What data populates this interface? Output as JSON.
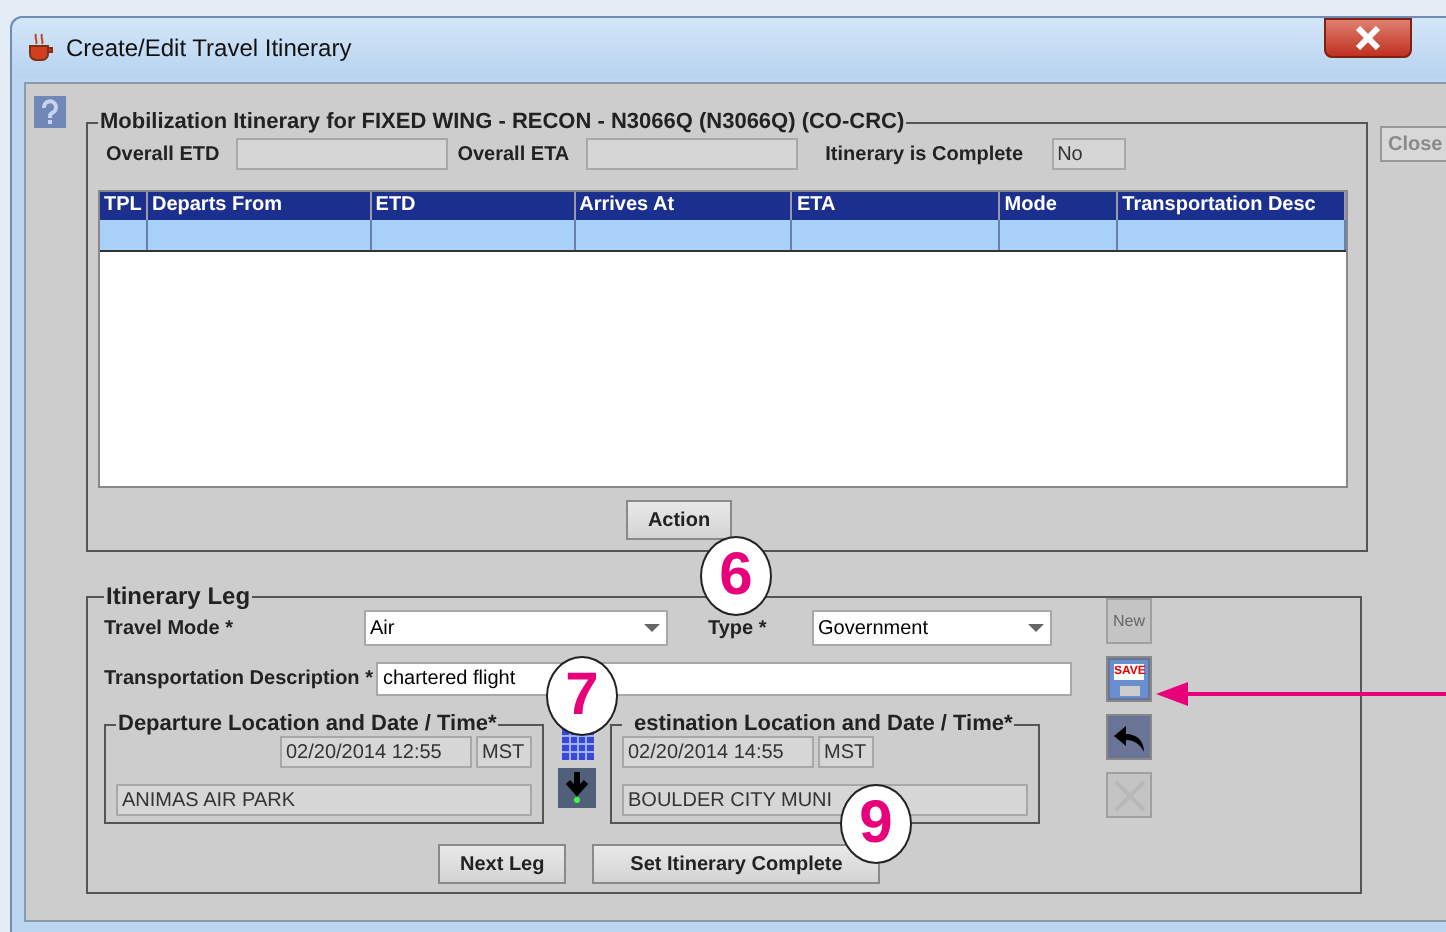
{
  "window": {
    "title": "Create/Edit Travel Itinerary"
  },
  "close_button": {
    "label": "Close",
    "disabled": true
  },
  "itinerary": {
    "title": "Mobilization Itinerary for FIXED WING - RECON - N3066Q (N3066Q) (CO-CRC)",
    "summary": [
      {
        "label": "Overall ETD"
      },
      {
        "label": "Overall ETA"
      },
      {
        "label": "Itinerary is Complete",
        "value": "No"
      }
    ],
    "table": {
      "columns": [
        "TPL",
        "Departs From",
        "ETD",
        "Arrives At",
        "ETA",
        "Mode",
        "Transportation Desc"
      ],
      "rows": [
        {
          "selected": true
        }
      ]
    },
    "action_button": "Action"
  },
  "leg": {
    "title": "Itinerary Leg",
    "travel_mode": {
      "label": "Travel Mode *",
      "value": "Air"
    },
    "type": {
      "label": "Type *",
      "value": "Government"
    },
    "description": {
      "label": "Transportation Description *",
      "value": "chartered flight"
    },
    "departure": {
      "title": "Departure Location and Date / Time*",
      "datetime": "02/20/2014 12:55",
      "zone": "MST",
      "location": "ANIMAS AIR PARK"
    },
    "destination": {
      "title": "estination Location and Date / Time*",
      "datetime": "02/20/2014 14:55",
      "zone": "MST",
      "location": "BOULDER CITY MUNI"
    },
    "side_buttons": [
      {
        "kind": "new",
        "label": "New",
        "disabled": true
      },
      {
        "kind": "save",
        "label": "SAVE",
        "disabled": false
      },
      {
        "kind": "undo",
        "disabled": false
      },
      {
        "kind": "delete",
        "disabled": true
      }
    ],
    "buttons": [
      "Next Leg",
      "Set Itinerary Complete"
    ]
  },
  "callouts": [
    "6",
    "7",
    "9"
  ]
}
